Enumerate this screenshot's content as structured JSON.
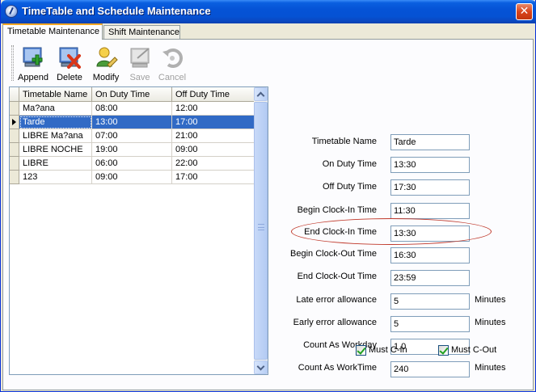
{
  "window": {
    "title": "TimeTable and Schedule Maintenance",
    "close_glyph": "✕"
  },
  "tabs": [
    {
      "label": "Timetable Maintenance",
      "active": true
    },
    {
      "label": "Shift Maintenance",
      "active": false
    }
  ],
  "toolbar": {
    "append": "Append",
    "delete": "Delete",
    "modify": "Modify",
    "save": "Save",
    "cancel": "Cancel"
  },
  "grid": {
    "columns": [
      "Timetable Name",
      "On Duty Time",
      "Off Duty Time"
    ],
    "rows": [
      [
        "Ma?ana",
        "08:00",
        "12:00"
      ],
      [
        "Tarde",
        "13:00",
        "17:00"
      ],
      [
        "LIBRE Ma?ana",
        "07:00",
        "21:00"
      ],
      [
        "LIBRE NOCHE",
        "19:00",
        "09:00"
      ],
      [
        "LIBRE",
        "06:00",
        "22:00"
      ],
      [
        "123",
        "09:00",
        "17:00"
      ]
    ],
    "selected_row": 1
  },
  "form": {
    "timetable_name": {
      "label": "Timetable Name",
      "value": "Tarde"
    },
    "on_duty": {
      "label": "On Duty Time",
      "value": "13:30"
    },
    "off_duty": {
      "label": "Off Duty Time",
      "value": "17:30"
    },
    "begin_in": {
      "label": "Begin Clock-In Time",
      "value": "11:30"
    },
    "end_in": {
      "label": "End Clock-In Time",
      "value": "13:30"
    },
    "begin_out": {
      "label": "Begin Clock-Out Time",
      "value": "16:30"
    },
    "end_out": {
      "label": "End Clock-Out Time",
      "value": "23:59"
    },
    "late": {
      "label": "Late error allowance",
      "value": "5",
      "unit": "Minutes"
    },
    "early": {
      "label": "Early error allowance",
      "value": "5",
      "unit": "Minutes"
    },
    "workday": {
      "label": "Count As Workday",
      "value": "1.0"
    },
    "worktime": {
      "label": "Count As WorkTime",
      "value": "240",
      "unit": "Minutes"
    },
    "must_cin": {
      "label": "Must C-In",
      "checked": true
    },
    "must_cout": {
      "label": "Must C-Out",
      "checked": true
    }
  },
  "colors": {
    "selection": "#316ac5",
    "titlebar": "#0553d6",
    "annotation": "#c0392b"
  }
}
